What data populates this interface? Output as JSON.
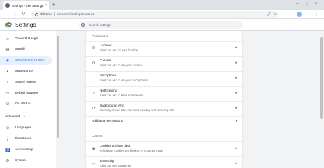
{
  "tab": {
    "title": "Settings - Site Settings",
    "close": "×",
    "new_tab": "+"
  },
  "window_controls": {
    "minimize": "–",
    "maximize": "□",
    "close": "×"
  },
  "address_bar": {
    "host": "Chrome",
    "separator": "|",
    "path": "chrome://settings/content"
  },
  "toolbar_icons": {
    "back": "←",
    "forward": "→",
    "reload": "↻",
    "share": "⤴",
    "star": "☆",
    "menu": "⋮"
  },
  "header": {
    "title": "Settings",
    "search_placeholder": "Search settings"
  },
  "sidebar": {
    "items": [
      {
        "label": "You and Google",
        "icon": "person-icon",
        "glyph": "☺",
        "active": false
      },
      {
        "label": "Autofill",
        "icon": "autofill-icon",
        "glyph": "▤",
        "active": false
      },
      {
        "label": "Security and Privacy",
        "icon": "shield-icon",
        "glyph": "◈",
        "active": true
      },
      {
        "label": "Appearance",
        "icon": "palette-icon",
        "glyph": "◐",
        "active": false
      },
      {
        "label": "Search engine",
        "icon": "search-icon",
        "glyph": "⌕",
        "active": false
      },
      {
        "label": "Default browser",
        "icon": "browser-icon",
        "glyph": "▭",
        "active": false
      },
      {
        "label": "On startup",
        "icon": "power-icon",
        "glyph": "⏻",
        "active": false
      }
    ],
    "advanced": {
      "label": "Advanced",
      "chevron": "▴"
    },
    "advanced_items": [
      {
        "label": "Languages",
        "icon": "globe-icon",
        "glyph": "⊕"
      },
      {
        "label": "Downloads",
        "icon": "download-icon",
        "glyph": "⤓"
      },
      {
        "label": "Accessibility",
        "icon": "accessibility-icon",
        "glyph": "♿"
      },
      {
        "label": "System",
        "icon": "wrench-icon",
        "glyph": "⚙"
      }
    ]
  },
  "main": {
    "permissions_label": "Permissions",
    "permissions": [
      {
        "title": "Location",
        "subtitle": "Sites can ask for your location",
        "icon": "location-icon",
        "glyph": "⊙"
      },
      {
        "title": "Camera",
        "subtitle": "Sites can ask to use your camera",
        "icon": "camera-icon",
        "glyph": "◘"
      },
      {
        "title": "Microphone",
        "subtitle": "Sites can ask to use your microphone",
        "icon": "microphone-icon",
        "glyph": "♪"
      },
      {
        "title": "Notifications",
        "subtitle": "Sites can ask to send notifications",
        "icon": "bell-icon",
        "glyph": "♫"
      },
      {
        "title": "Background sync",
        "subtitle": "Recently closed sites can finish sending and receiving data",
        "icon": "sync-icon",
        "glyph": "⟳"
      }
    ],
    "additional_permissions": "Additional permissions",
    "content_label": "Content",
    "content": [
      {
        "title": "Cookies and site data",
        "subtitle": "Third-party cookies are blocked in Incognito mode",
        "icon": "cookie-icon",
        "glyph": "◉"
      },
      {
        "title": "JavaScript",
        "subtitle": "Sites can use Javascript",
        "icon": "code-icon",
        "glyph": "‹›"
      }
    ],
    "arrow": "▸",
    "chevron_down": "▾"
  }
}
